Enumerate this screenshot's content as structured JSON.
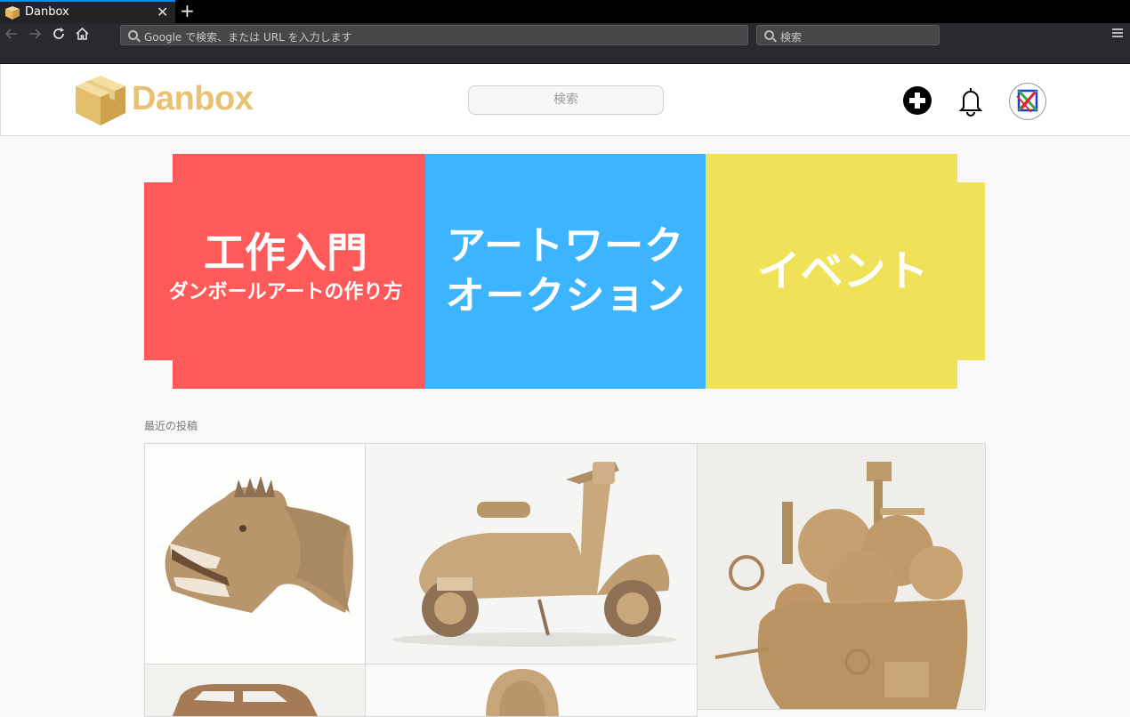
{
  "browser": {
    "tab_title": "Danbox",
    "tab_close": "✕",
    "new_tab": "+",
    "url_placeholder": "Google で検索、または URL を入力します",
    "search_placeholder": "検索"
  },
  "site": {
    "logo_text": "Danbox",
    "search_placeholder": "検索"
  },
  "banners": {
    "beginner_title": "工作入門",
    "beginner_subtitle": "ダンボールアートの作り方",
    "auction_line1": "アートワーク",
    "auction_line2": "オークション",
    "event_title": "イベント"
  },
  "recent": {
    "heading": "最近の投稿",
    "posts": [
      "dinosaur-head",
      "scooter",
      "moving-castle",
      "car",
      "helmet"
    ]
  },
  "colors": {
    "red": "#ff5a5a",
    "blue": "#3cb4ff",
    "yellow": "#f0e258",
    "logo": "#e8c270",
    "cardboard": "#c9a674"
  },
  "icons": [
    "back-arrow-icon",
    "forward-arrow-icon",
    "reload-icon",
    "home-icon",
    "search-icon",
    "menu-icon",
    "plus-circle-icon",
    "bell-icon",
    "avatar-icon"
  ]
}
